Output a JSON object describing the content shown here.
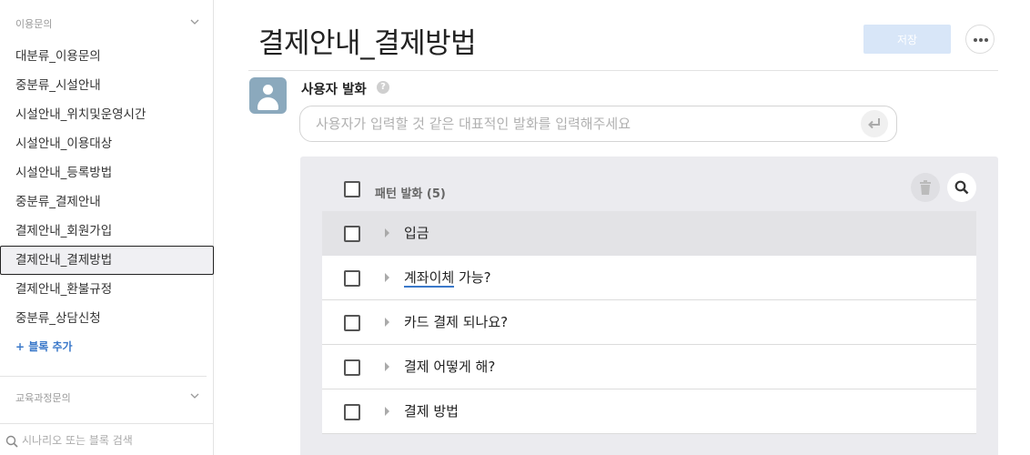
{
  "sidebar": {
    "group1_title": "이용문의",
    "items": [
      {
        "label": "대분류_이용문의"
      },
      {
        "label": "중분류_시설안내"
      },
      {
        "label": "시설안내_위치및운영시간"
      },
      {
        "label": "시설안내_이용대상"
      },
      {
        "label": "시설안내_등록방법"
      },
      {
        "label": "중분류_결제안내"
      },
      {
        "label": "결제안내_회원가입"
      },
      {
        "label": "결제안내_결제방법",
        "active": true
      },
      {
        "label": "결제안내_환불규정"
      },
      {
        "label": "중분류_상담신청"
      }
    ],
    "add_block_label": "+ 블록 추가",
    "group2_title": "교육과정문의",
    "search_placeholder": "시나리오 또는 블록 검색"
  },
  "header": {
    "title": "결제안내_결제방법",
    "save_label": "저장"
  },
  "user_utterance": {
    "label": "사용자 발화",
    "help": "?",
    "placeholder": "사용자가 입력할 것 같은 대표적인 발화를 입력해주세요"
  },
  "patterns": {
    "title": "패턴 발화 (5)",
    "rows": [
      {
        "text": "입금"
      },
      {
        "text_underlined": "계좌이체",
        "text_rest": " 가능?"
      },
      {
        "text": "카드 결제 되나요?"
      },
      {
        "text": "결제 어떻게 해?"
      },
      {
        "text": "결제 방법"
      }
    ]
  },
  "colors": {
    "accent": "#3a78c9",
    "save_button_bg": "#d8e6f8",
    "panel_bg": "#ebebef",
    "avatar_bg": "#8ba9bd"
  },
  "icons": [
    "chevron-down-icon",
    "search-icon",
    "help-icon",
    "enter-icon",
    "trash-icon",
    "more-icon",
    "user-avatar-icon",
    "expand-arrow-icon"
  ]
}
